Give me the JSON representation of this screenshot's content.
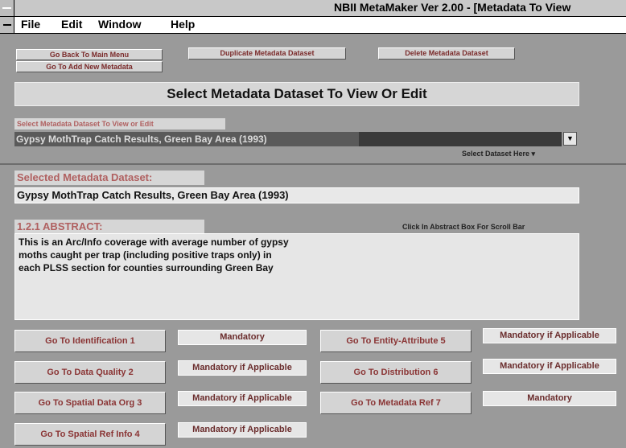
{
  "window": {
    "title": "NBII MetaMaker Ver 2.00 - [Metadata To View"
  },
  "menu": {
    "items": [
      "File",
      "Edit",
      "Window",
      "Help"
    ]
  },
  "top_buttons": {
    "back_main": "Go Back To Main Menu",
    "add_new": "Go To Add New Metadata",
    "duplicate": "Duplicate Metadata Dataset",
    "delete": "Delete Metadata Dataset"
  },
  "banner": "Select Metadata Dataset To View Or Edit",
  "select_section": {
    "label": "Select Metadata Dataset To View or Edit",
    "selected_value": "Gypsy MothTrap Catch Results, Green Bay Area (1993)",
    "dropdown_icon": "chevron-down-icon",
    "hint": "Select Dataset Here"
  },
  "selected_section": {
    "label": "Selected Metadata Dataset:",
    "value": "Gypsy MothTrap Catch Results, Green Bay Area (1993)"
  },
  "abstract_section": {
    "label": "1.2.1 ABSTRACT:",
    "hint": "Click In Abstract Box For Scroll Bar",
    "text": "This is an Arc/Info coverage with average number of gypsy\nmoths caught per trap (including positive traps only) in\neach PLSS section for counties surrounding Green Bay"
  },
  "nav_buttons": [
    {
      "label": "Go To Identification 1",
      "status": "Mandatory"
    },
    {
      "label": "Go To Data Quality 2",
      "status": "Mandatory if Applicable"
    },
    {
      "label": "Go To Spatial Data Org 3",
      "status": "Mandatory if Applicable"
    },
    {
      "label": "Go To Spatial Ref Info 4",
      "status": "Mandatory if Applicable"
    },
    {
      "label": "Go To Entity-Attribute 5",
      "status": "Mandatory if Applicable"
    },
    {
      "label": "Go To Distribution 6",
      "status": "Mandatory if Applicable"
    },
    {
      "label": "Go To Metadata Ref 7",
      "status": "Mandatory"
    }
  ]
}
